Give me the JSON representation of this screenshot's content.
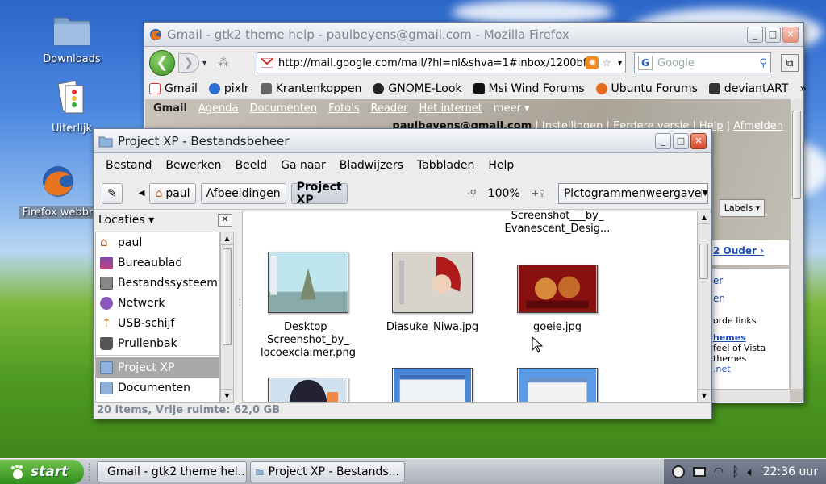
{
  "desktop": {
    "icons": [
      {
        "label": "Downloads"
      },
      {
        "label": "Uiterlijk"
      },
      {
        "label": "Firefox webbr"
      }
    ]
  },
  "firefox": {
    "title": "Gmail - gtk2 theme help - paulbeyens@gmail.com - Mozilla Firefox",
    "url": "http://mail.google.com/mail/?hl=nl&shva=1#inbox/1200bf",
    "search_placeholder": "Google",
    "bookmarks": [
      "Gmail",
      "pixlr",
      "Krantenkoppen",
      "GNOME-Look",
      "Msi Wind Forums",
      "Ubuntu Forums",
      "deviantART"
    ],
    "bookmarks_more": "»",
    "gmail_nav": [
      "Gmail",
      "Agenda",
      "Documenten",
      "Foto's",
      "Reader",
      "Het internet",
      "meer ▾"
    ],
    "account_email": "paulbeyens@gmail.com",
    "account_links": [
      "Instellingen",
      "Eerdere versie",
      "Help",
      "Afmelden"
    ],
    "labels_button": "Labels ▾",
    "older_text": "2 Ouder ›",
    "panel_lines": [
      "er",
      "en",
      "orde links",
      "hemes",
      "feel of Vista",
      "themes",
      ".net"
    ]
  },
  "nautilus": {
    "title": "Project XP - Bestandsbeheer",
    "menu": [
      "Bestand",
      "Bewerken",
      "Beeld",
      "Ga naar",
      "Bladwijzers",
      "Tabbladen",
      "Help"
    ],
    "path": [
      "paul",
      "Afbeeldingen",
      "Project XP"
    ],
    "zoom": "100%",
    "view_mode": "Pictogrammenweergave",
    "sidebar_title": "Locaties ▾",
    "places": [
      "paul",
      "Bureaublad",
      "Bestandssysteem",
      "Netwerk",
      "USB-schijf",
      "Prullenbak",
      "Project XP",
      "Documenten"
    ],
    "files": {
      "top": "Screenshot___by_\nEvanescent_Desig...",
      "f1": "Desktop_\nScreenshot_by_\nlocoexclaimer.png",
      "f2": "Diasuke_Niwa.jpg",
      "f3": "goeie.jpg"
    },
    "status": "20 items, Vrije ruimte: 62,0 GB"
  },
  "taskbar": {
    "start": "start",
    "tasks": [
      "Gmail - gtk2 theme hel...",
      "Project XP - Bestands..."
    ],
    "clock": "22:36 uur"
  }
}
